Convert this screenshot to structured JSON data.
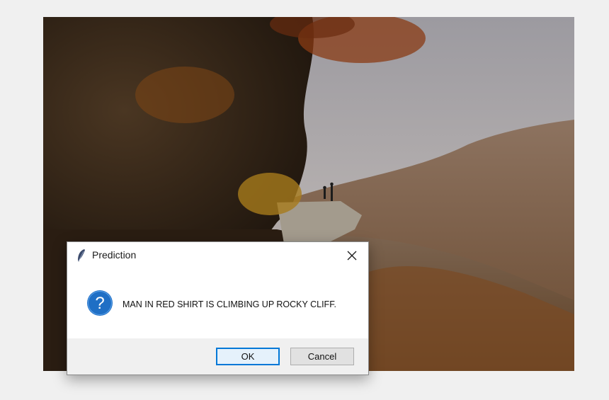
{
  "background_photo": {
    "description_icon": "autumn-cliff-photo"
  },
  "dialog": {
    "title": "Prediction",
    "app_icon": "feather-icon",
    "close_icon": "close-icon",
    "message_icon": "question-icon",
    "message": "MAN IN RED SHIRT IS CLIMBING UP ROCKY CLIFF.",
    "buttons": {
      "ok": "OK",
      "cancel": "Cancel"
    },
    "colors": {
      "question_blue": "#1f6fc5",
      "focus_border": "#0078d7"
    }
  }
}
